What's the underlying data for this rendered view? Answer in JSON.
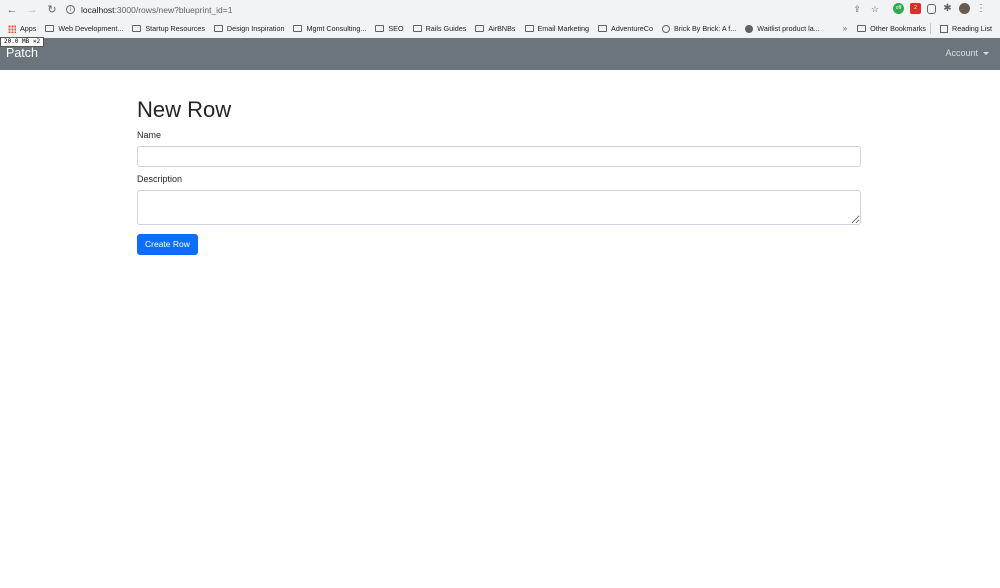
{
  "browser": {
    "url_host": "localhost",
    "url_path": ":3000/rows/new?blueprint_id=1",
    "bookmarks": [
      {
        "label": "Apps",
        "icon": "apps-grid-icon"
      },
      {
        "label": "Web Development...",
        "icon": "folder-icon"
      },
      {
        "label": "Startup Resources",
        "icon": "folder-icon"
      },
      {
        "label": "Design Inspiration",
        "icon": "folder-icon"
      },
      {
        "label": "Mgmt Consulting...",
        "icon": "folder-icon"
      },
      {
        "label": "SEO",
        "icon": "folder-icon"
      },
      {
        "label": "Rails Guides",
        "icon": "folder-icon"
      },
      {
        "label": "AirBNBs",
        "icon": "folder-icon"
      },
      {
        "label": "Email Marketing",
        "icon": "folder-icon"
      },
      {
        "label": "AdventureCo",
        "icon": "folder-icon"
      },
      {
        "label": "Brick By Brick: A f...",
        "icon": "globe-icon"
      },
      {
        "label": "Waitlist product la...",
        "icon": "globe-icon"
      }
    ],
    "overflow_label": "»",
    "other_bookmarks": "Other Bookmarks",
    "reading_list": "Reading List",
    "ext_badge_1": "off",
    "ext_badge_2": "2"
  },
  "perf_badge": "20.0 MB ×2",
  "navbar": {
    "brand": "Patch",
    "account_label": "Account",
    "bg_color": "#6c757d"
  },
  "form": {
    "title": "New Row",
    "name_label": "Name",
    "name_value": "",
    "description_label": "Description",
    "description_value": "",
    "submit_label": "Create Row",
    "accent_color": "#0d6efd"
  }
}
